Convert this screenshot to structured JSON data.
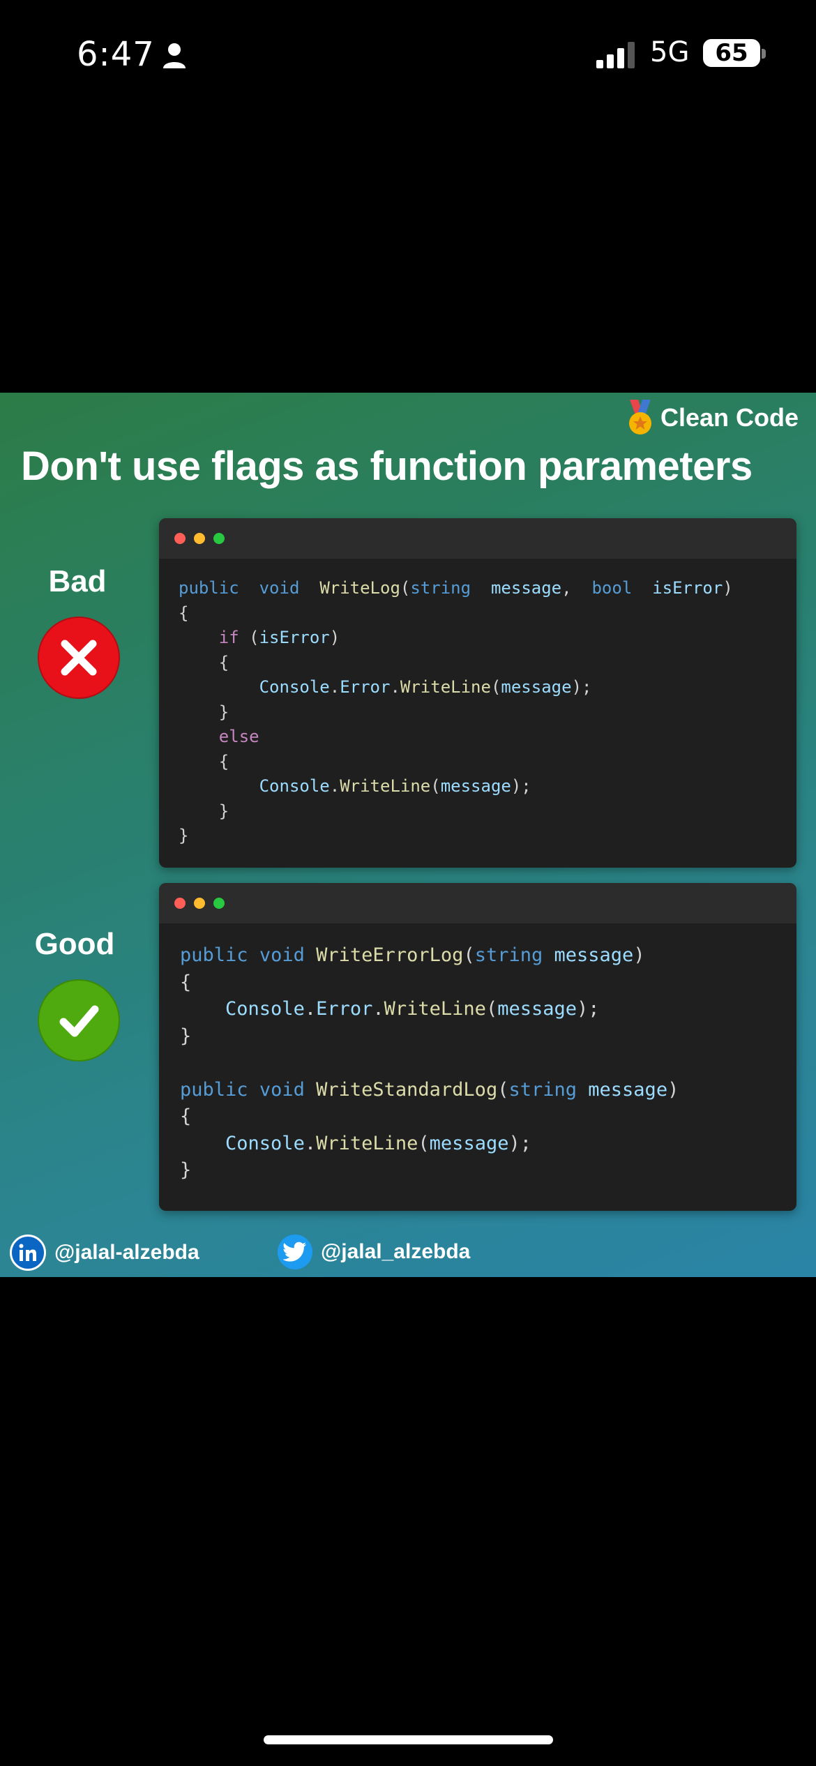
{
  "status_bar": {
    "time": "6:47",
    "network": "5G",
    "battery": "65"
  },
  "post": {
    "tag": "Clean Code",
    "headline": "Don't use flags as function parameters",
    "bad_label": "Bad",
    "good_label": "Good",
    "bad_code": [
      [
        [
          "kw",
          "public"
        ],
        [
          "",
          "  "
        ],
        [
          "kw",
          "void"
        ],
        [
          "",
          "  "
        ],
        [
          "fn",
          "WriteLog"
        ],
        [
          "",
          "("
        ],
        [
          "kw",
          "string"
        ],
        [
          "",
          "  "
        ],
        [
          "var",
          "message"
        ],
        [
          "",
          ",  "
        ],
        [
          "kw",
          "bool"
        ],
        [
          "",
          "  "
        ],
        [
          "var",
          "isError"
        ],
        [
          "",
          ")"
        ]
      ],
      [
        [
          "",
          "{"
        ]
      ],
      [
        [
          "",
          "    "
        ],
        [
          "ctl",
          "if"
        ],
        [
          "",
          " ("
        ],
        [
          "var",
          "isError"
        ],
        [
          "",
          ")"
        ]
      ],
      [
        [
          "",
          "    {"
        ]
      ],
      [
        [
          "",
          "        "
        ],
        [
          "cls",
          "Console"
        ],
        [
          "",
          "."
        ],
        [
          "cls",
          "Error"
        ],
        [
          "",
          "."
        ],
        [
          "fn",
          "WriteLine"
        ],
        [
          "",
          "("
        ],
        [
          "var",
          "message"
        ],
        [
          "",
          ");"
        ]
      ],
      [
        [
          "",
          "    }"
        ]
      ],
      [
        [
          "",
          "    "
        ],
        [
          "ctl",
          "else"
        ]
      ],
      [
        [
          "",
          "    {"
        ]
      ],
      [
        [
          "",
          "        "
        ],
        [
          "cls",
          "Console"
        ],
        [
          "",
          "."
        ],
        [
          "fn",
          "WriteLine"
        ],
        [
          "",
          "("
        ],
        [
          "var",
          "message"
        ],
        [
          "",
          ");"
        ]
      ],
      [
        [
          "",
          "    }"
        ]
      ],
      [
        [
          "",
          "}"
        ]
      ]
    ],
    "good_code": [
      [
        [
          "kw",
          "public"
        ],
        [
          "",
          " "
        ],
        [
          "kw",
          "void"
        ],
        [
          "",
          " "
        ],
        [
          "fn",
          "WriteErrorLog"
        ],
        [
          "",
          "("
        ],
        [
          "kw",
          "string"
        ],
        [
          "",
          " "
        ],
        [
          "var",
          "message"
        ],
        [
          "",
          ")"
        ]
      ],
      [
        [
          "",
          "{"
        ]
      ],
      [
        [
          "",
          "    "
        ],
        [
          "cls",
          "Console"
        ],
        [
          "",
          "."
        ],
        [
          "cls",
          "Error"
        ],
        [
          "",
          "."
        ],
        [
          "fn",
          "WriteLine"
        ],
        [
          "",
          "("
        ],
        [
          "var",
          "message"
        ],
        [
          "",
          ");"
        ]
      ],
      [
        [
          "",
          "}"
        ]
      ],
      [
        [
          "",
          ""
        ]
      ],
      [
        [
          "kw",
          "public"
        ],
        [
          "",
          " "
        ],
        [
          "kw",
          "void"
        ],
        [
          "",
          " "
        ],
        [
          "fn",
          "WriteStandardLog"
        ],
        [
          "",
          "("
        ],
        [
          "kw",
          "string"
        ],
        [
          "",
          " "
        ],
        [
          "var",
          "message"
        ],
        [
          "",
          ")"
        ]
      ],
      [
        [
          "",
          "{"
        ]
      ],
      [
        [
          "",
          "    "
        ],
        [
          "cls",
          "Console"
        ],
        [
          "",
          "."
        ],
        [
          "fn",
          "WriteLine"
        ],
        [
          "",
          "("
        ],
        [
          "var",
          "message"
        ],
        [
          "",
          ");"
        ]
      ],
      [
        [
          "",
          "}"
        ]
      ]
    ],
    "linkedin_handle": "@jalal-alzebda",
    "twitter_handle": "@jalal_alzebda"
  },
  "icons": {
    "person": "person-icon",
    "signal": "signal-icon",
    "medal": "medal-icon",
    "bad": "x-circle-icon",
    "good": "checkmark-circle-icon",
    "linkedin": "linkedin-icon",
    "twitter": "twitter-icon"
  },
  "colors": {
    "bad": "#e8111a",
    "good": "#4eaa0e",
    "keyword": "#569cd6",
    "function": "#dcdcaa",
    "variable": "#9cdcfe",
    "control": "#c586c0",
    "dot_red": "#ff5f57",
    "dot_yellow": "#febc2e",
    "dot_green": "#28c840"
  }
}
